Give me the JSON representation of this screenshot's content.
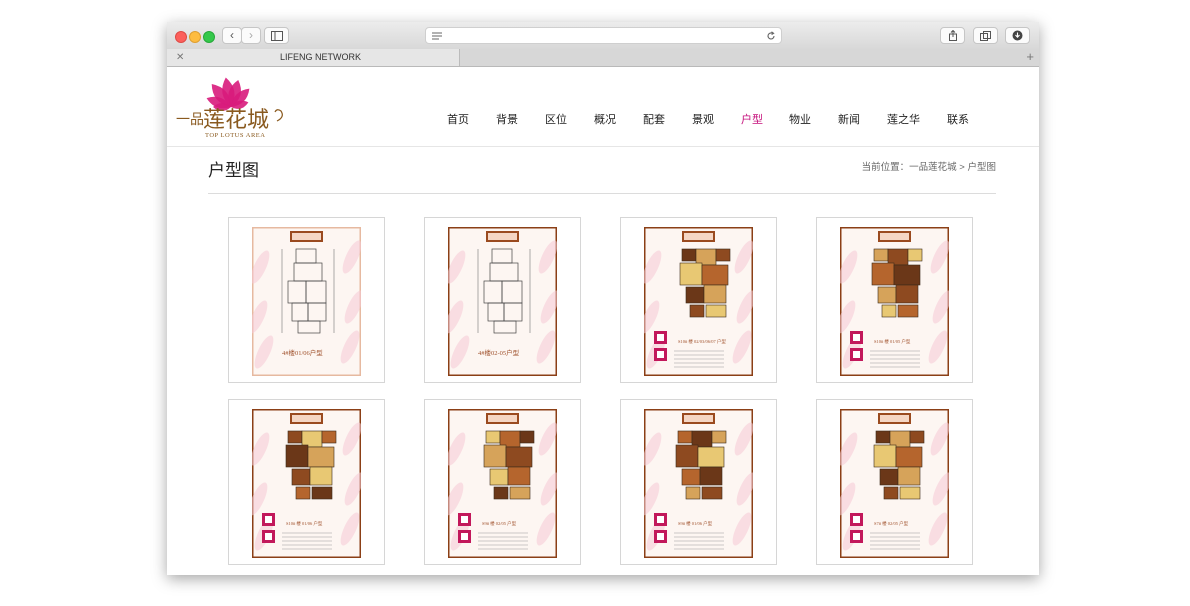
{
  "browser": {
    "tab_title": "LIFENG NETWORK",
    "tab_close": "✕",
    "tab_plus": "+",
    "btn_back": "‹",
    "btn_forward": "›"
  },
  "logo": {
    "brand_cn": "一品莲花城",
    "brand_en": "TOP LOTUS AREA",
    "colors": {
      "petal": "#d81b7c",
      "text": "#8a5a1f"
    }
  },
  "nav": {
    "items": [
      {
        "label": "首页"
      },
      {
        "label": "背景"
      },
      {
        "label": "区位"
      },
      {
        "label": "概况"
      },
      {
        "label": "配套"
      },
      {
        "label": "景观"
      },
      {
        "label": "户型"
      },
      {
        "label": "物业"
      },
      {
        "label": "新闻"
      },
      {
        "label": "莲之华"
      },
      {
        "label": "联系"
      }
    ],
    "active_index": 6,
    "active_color": "#c6117c"
  },
  "page": {
    "title": "户型图",
    "breadcrumb": {
      "prefix": "当前位置：",
      "home": "一品莲花城",
      "separator": ">",
      "current": "户型图"
    }
  },
  "gallery": {
    "items": [
      {
        "caption": "4#楼01/06户型",
        "style": "lineart",
        "frame": "light"
      },
      {
        "caption": "4#楼02-05户型",
        "style": "lineart",
        "frame": "dark"
      },
      {
        "caption": "S10# 楼 02/03/06/07 户型",
        "style": "color",
        "frame": "dark"
      },
      {
        "caption": "S10# 楼 01/05 户型",
        "style": "color",
        "frame": "dark"
      },
      {
        "caption": "S10# 楼 01/06 户型",
        "style": "color",
        "frame": "dark"
      },
      {
        "caption": "S9# 楼 02/05 户型",
        "style": "color",
        "frame": "dark"
      },
      {
        "caption": "S9# 楼 01/06 户型",
        "style": "color",
        "frame": "dark"
      },
      {
        "caption": "S7# 楼 02/05 户型",
        "style": "color",
        "frame": "dark"
      }
    ]
  }
}
